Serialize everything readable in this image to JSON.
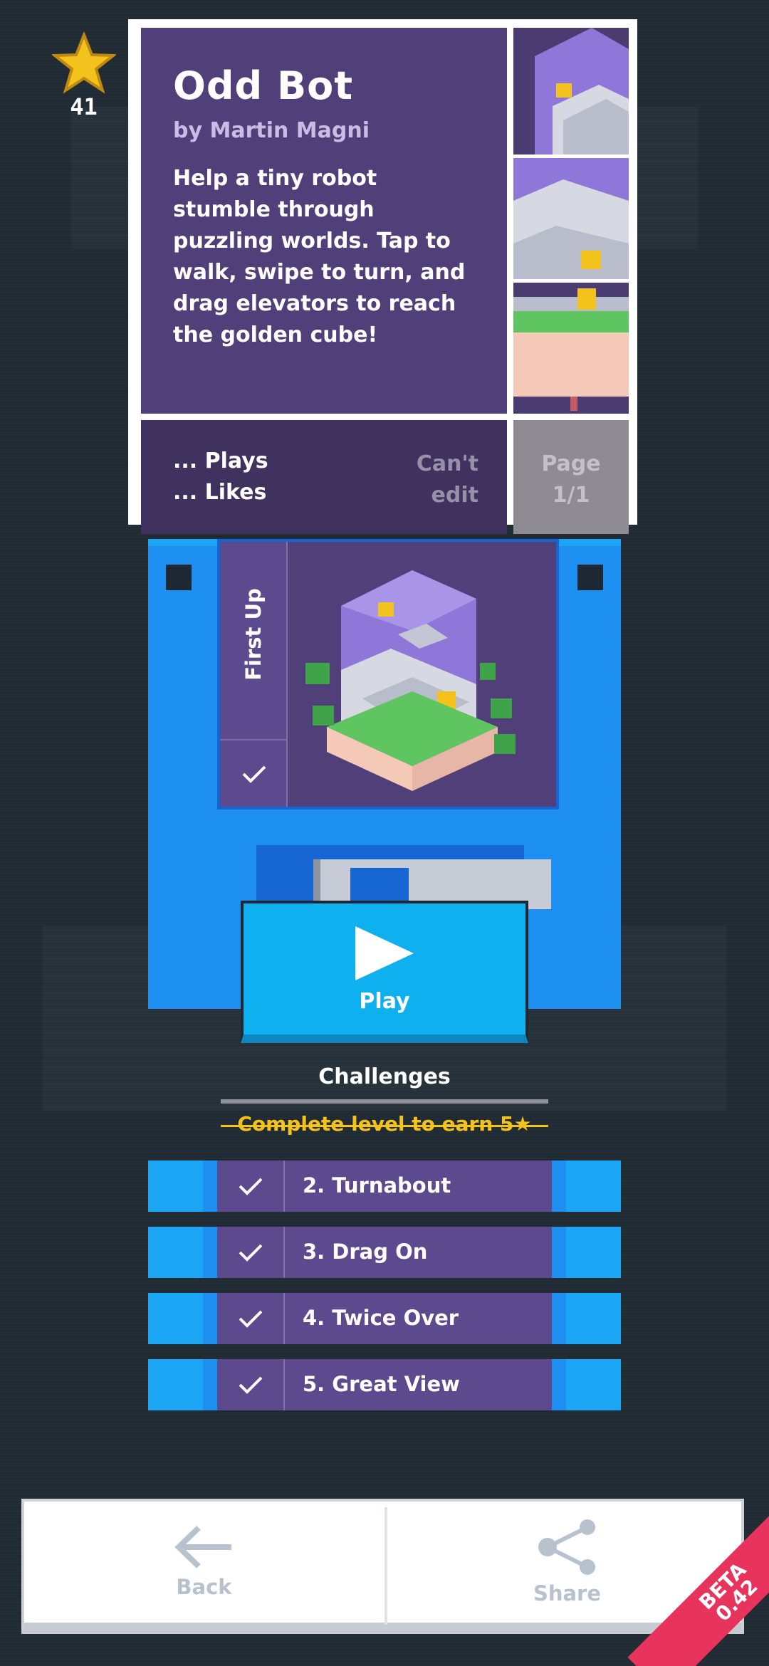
{
  "stars": {
    "count": "41"
  },
  "level_info": {
    "title": "Odd Bot",
    "author": "by Martin Magni",
    "description": "Help a tiny robot stumble through puzzling worlds. Tap to walk, swipe to turn, and drag elevators to reach the golden cube!",
    "plays": "... Plays",
    "likes": "... Likes",
    "edit_line1": "Can't",
    "edit_line2": "edit",
    "page_line1": "Page",
    "page_line2": "1/1"
  },
  "disk": {
    "level_name": "First Up",
    "play_label": "Play"
  },
  "challenges": {
    "title": "Challenges",
    "earn_text": "Complete level to earn 5★",
    "items": [
      {
        "label": "2. Turnabout",
        "done": true
      },
      {
        "label": "3. Drag On",
        "done": true
      },
      {
        "label": "4. Twice Over",
        "done": true
      },
      {
        "label": "5. Great View",
        "done": true
      }
    ]
  },
  "bottom_bar": {
    "back_label": "Back",
    "share_label": "Share"
  },
  "badge": {
    "line1": "BETA",
    "line2": "0.42"
  },
  "colors": {
    "accent_blue": "#1c8ff0",
    "panel_purple": "#513f7a",
    "star_yellow": "#f3c21c",
    "beta_red": "#e8335d"
  }
}
